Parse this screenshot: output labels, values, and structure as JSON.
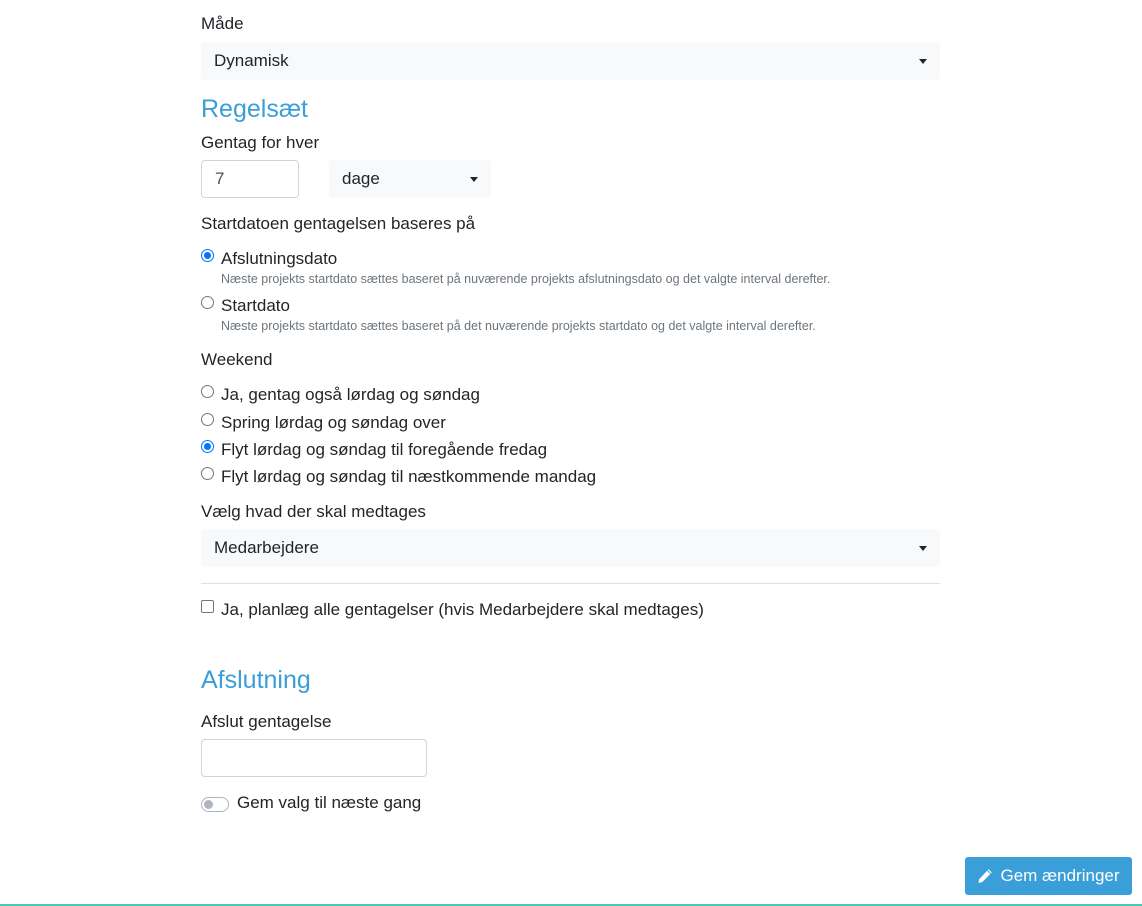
{
  "mode": {
    "label": "Måde",
    "selected": "Dynamisk"
  },
  "ruleset": {
    "title": "Regelsæt",
    "repeat_label": "Gentag for hver",
    "repeat_value": "7",
    "repeat_unit": "dage"
  },
  "start_basis": {
    "label": "Startdatoen gentagelsen baseres på",
    "options": [
      {
        "label": "Afslutningsdato",
        "help": "Næste projekts startdato sættes baseret på nuværende projekts afslutningsdato og det valgte interval derefter.",
        "checked": true
      },
      {
        "label": "Startdato",
        "help": "Næste projekts startdato sættes baseret på det nuværende projekts startdato og det valgte interval derefter.",
        "checked": false
      }
    ]
  },
  "weekend": {
    "label": "Weekend",
    "options": [
      {
        "label": "Ja, gentag også lørdag og søndag",
        "checked": false
      },
      {
        "label": "Spring lørdag og søndag over",
        "checked": false
      },
      {
        "label": "Flyt lørdag og søndag til foregående fredag",
        "checked": true
      },
      {
        "label": "Flyt lørdag og søndag til næstkommende mandag",
        "checked": false
      }
    ]
  },
  "include": {
    "label": "Vælg hvad der skal medtages",
    "selected": "Medarbejdere"
  },
  "plan_all": {
    "label": "Ja, planlæg alle gentagelser (hvis Medarbejdere skal medtages)",
    "checked": false
  },
  "ending": {
    "title": "Afslutning",
    "end_label": "Afslut gentagelse",
    "end_value": "",
    "remember_label": "Gem valg til næste gang",
    "remember_on": false
  },
  "save_button": {
    "label": "Gem ændringer",
    "icon": "pencil-icon"
  },
  "colors": {
    "accent": "#3a9fd8",
    "radio_checked": "#0075ff",
    "bottom_line": "#4fc3b5"
  }
}
